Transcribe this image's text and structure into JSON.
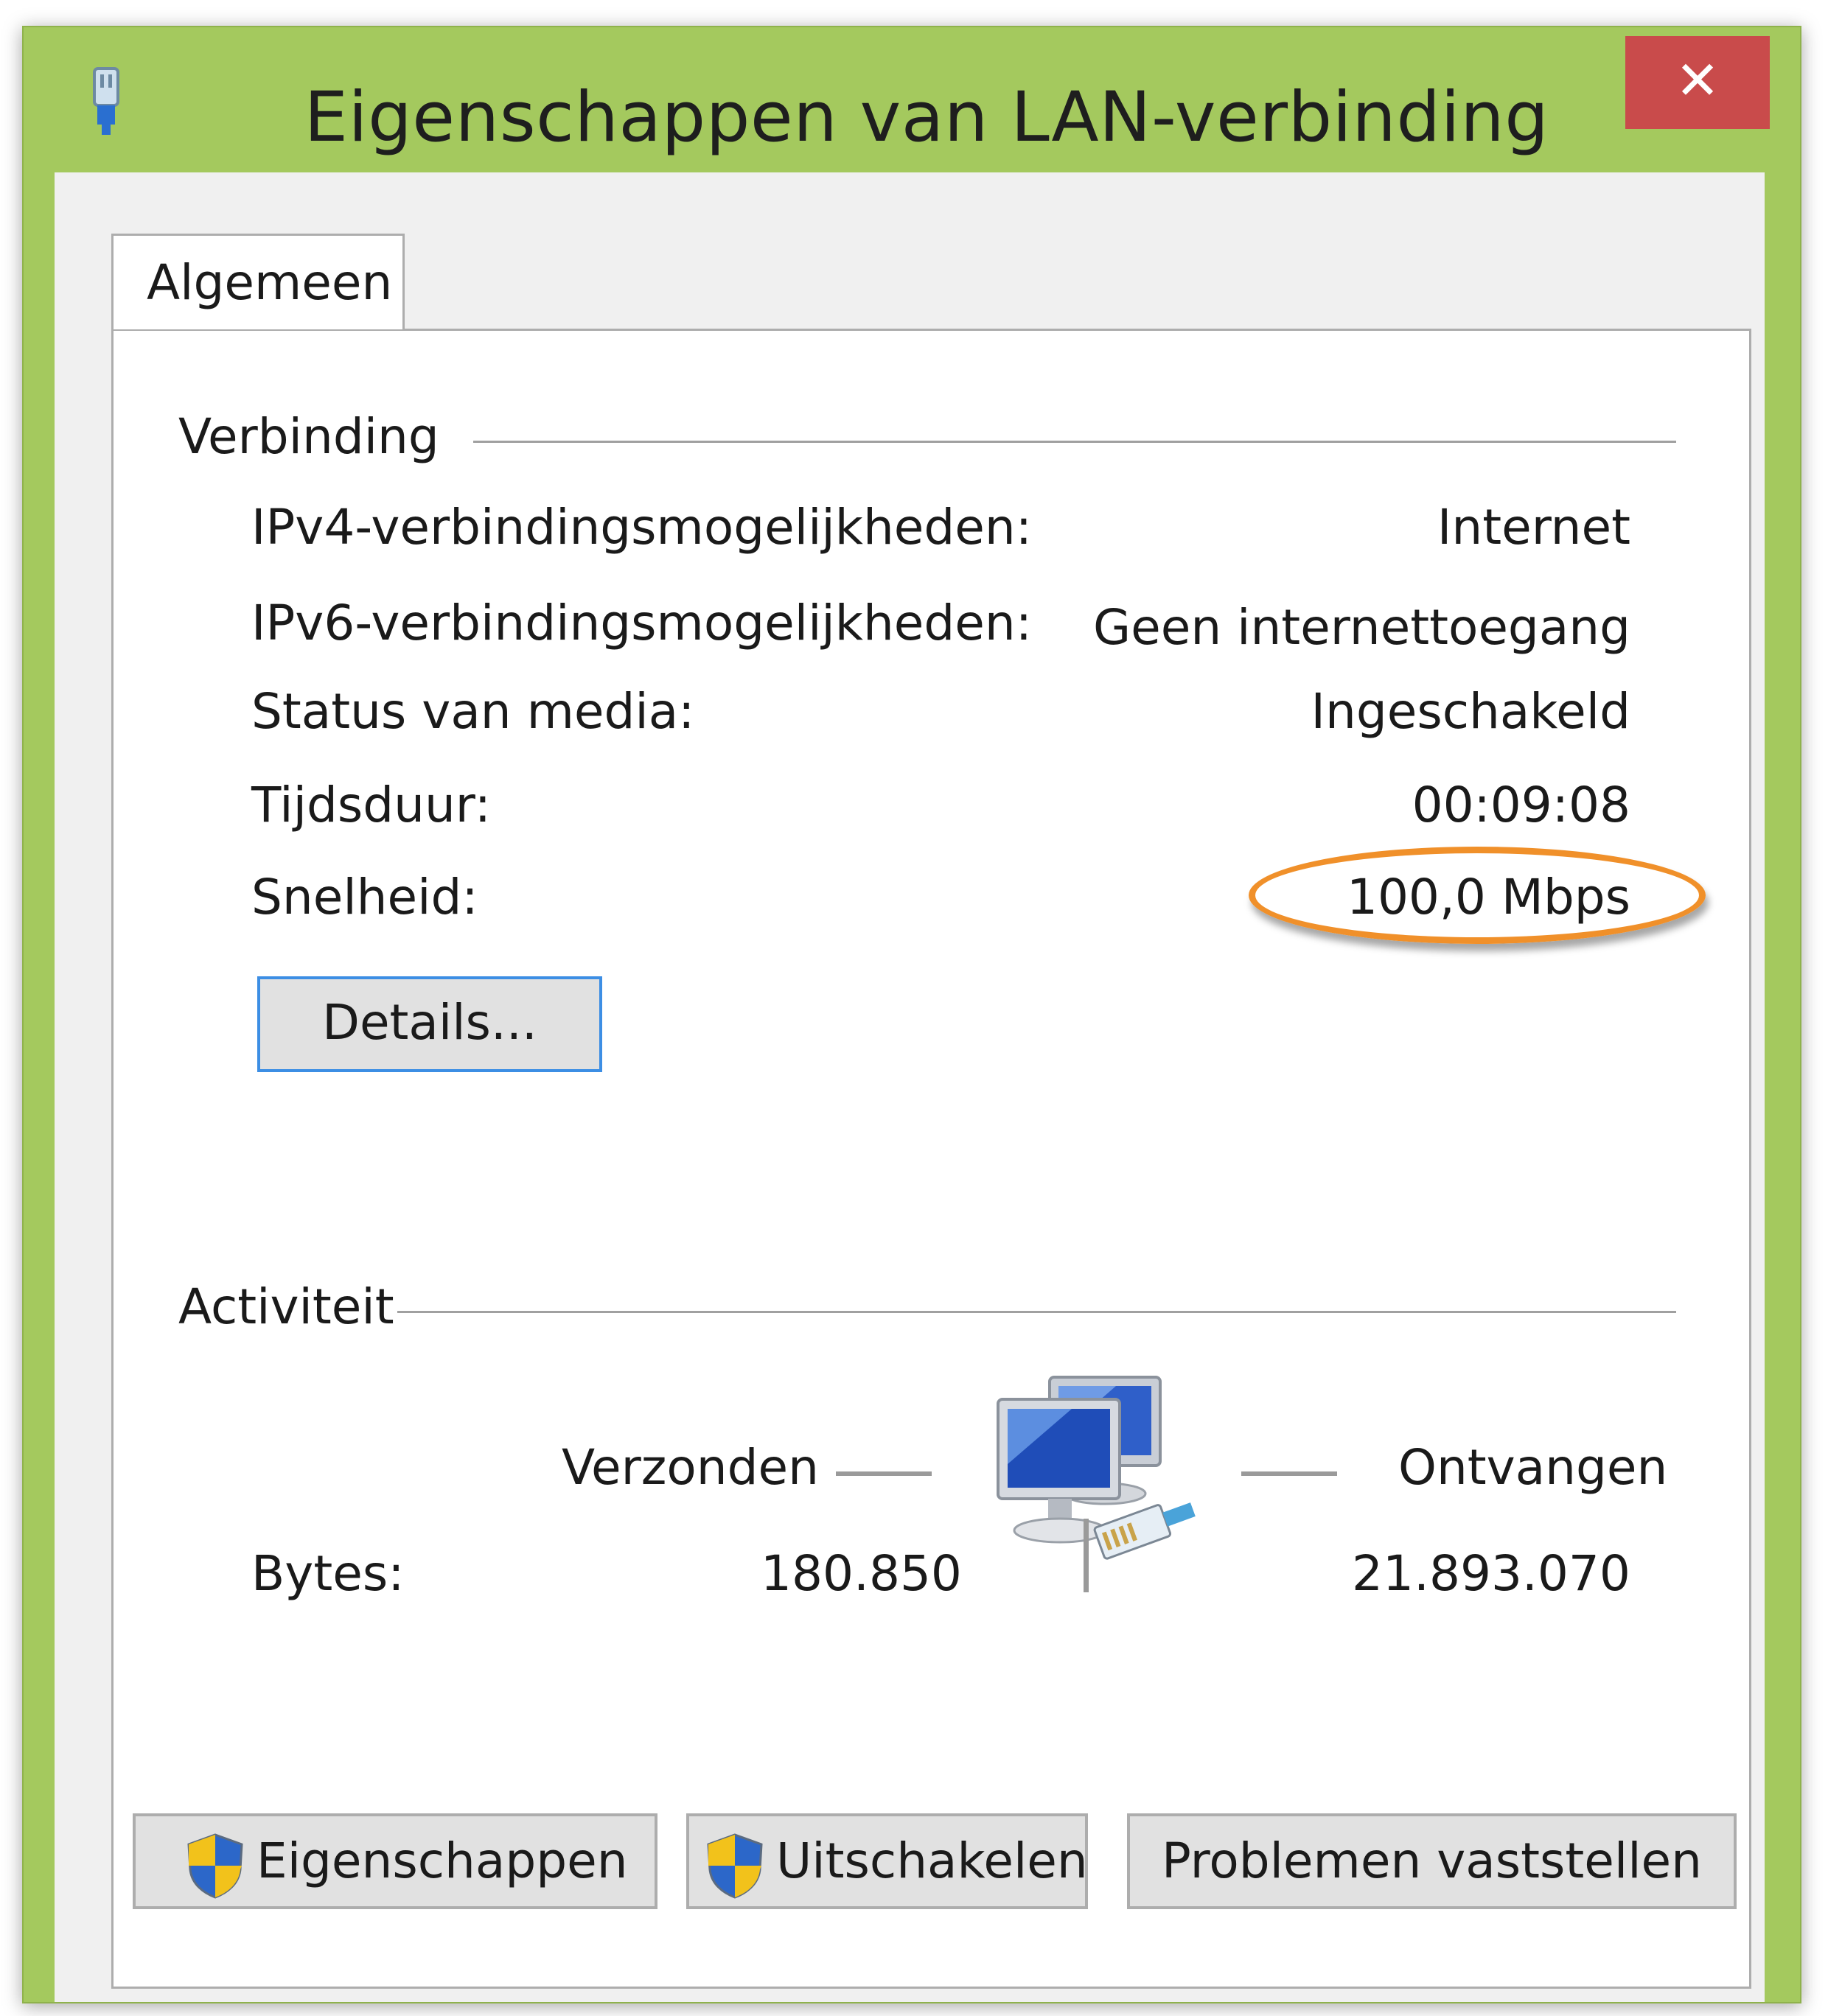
{
  "window": {
    "title": "Eigenschappen van LAN-verbinding",
    "close_label": "✕"
  },
  "tabs": [
    {
      "label": "Algemeen",
      "selected": true
    }
  ],
  "connection": {
    "group_title": "Verbinding",
    "rows": [
      {
        "label": "IPv4-verbindingsmogelijkheden:",
        "value": "Internet"
      },
      {
        "label": "IPv6-verbindingsmogelijkheden:",
        "value": "Geen internettoegang"
      },
      {
        "label": "Status van media:",
        "value": "Ingeschakeld"
      },
      {
        "label": "Tijdsduur:",
        "value": "00:09:08"
      },
      {
        "label": "Snelheid:",
        "value": "100,0 Mbps"
      }
    ],
    "details_button": "Details..."
  },
  "activity": {
    "group_title": "Activiteit",
    "sent_label": "Verzonden",
    "received_label": "Ontvangen",
    "bytes_label": "Bytes:",
    "bytes_sent": "180.850",
    "bytes_received": "21.893.070"
  },
  "buttons": {
    "properties": "Eigenschappen",
    "disable": "Uitschakelen",
    "diagnose": "Problemen vaststellen"
  },
  "colors": {
    "window_frame": "#a4c95e",
    "close_button": "#c94b4b",
    "highlight": "#f0902a",
    "focus_border": "#3c8ee4"
  },
  "icons": {
    "app": "network-adapter-icon",
    "network": "network-computers-icon",
    "uac": "uac-shield-icon"
  }
}
